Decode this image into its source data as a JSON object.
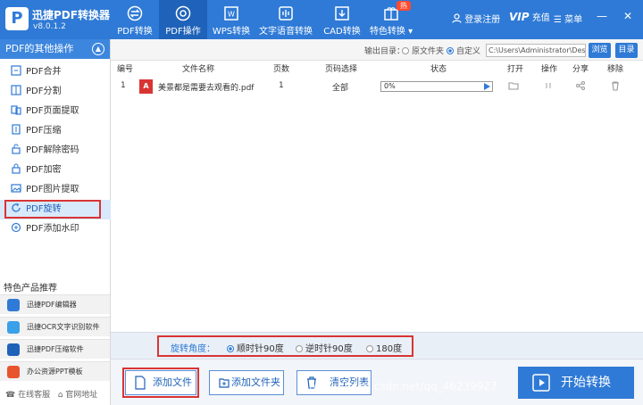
{
  "app": {
    "title": "迅捷PDF转换器",
    "version": "v8.0.1.2",
    "logo_letter": "P"
  },
  "nav": {
    "tabs": [
      {
        "label": "PDF转换",
        "icon": "convert-icon"
      },
      {
        "label": "PDF操作",
        "icon": "gear-icon",
        "active": true
      },
      {
        "label": "WPS转换",
        "icon": "wps-icon"
      },
      {
        "label": "文字语音转换",
        "icon": "audio-wave-icon"
      },
      {
        "label": "CAD转换",
        "icon": "cad-icon"
      },
      {
        "label": "特色转换",
        "icon": "gift-icon",
        "badge": "热"
      }
    ]
  },
  "topright": {
    "login": "登录注册",
    "vip": "VIP",
    "recharge": "充值",
    "menu": "菜单"
  },
  "sidebar": {
    "header": "PDF的其他操作",
    "items": [
      {
        "label": "PDF合并",
        "icon": "merge-icon"
      },
      {
        "label": "PDF分割",
        "icon": "split-icon"
      },
      {
        "label": "PDF页面提取",
        "icon": "extract-icon"
      },
      {
        "label": "PDF压缩",
        "icon": "compress-icon"
      },
      {
        "label": "PDF解除密码",
        "icon": "unlock-icon"
      },
      {
        "label": "PDF加密",
        "icon": "lock-icon"
      },
      {
        "label": "PDF图片提取",
        "icon": "image-icon"
      },
      {
        "label": "PDF旋转",
        "icon": "rotate-icon",
        "active": true
      },
      {
        "label": "PDF添加水印",
        "icon": "watermark-icon"
      }
    ],
    "promo_title": "特色产品推荐",
    "promos": [
      {
        "label": "迅捷PDF编辑器",
        "color": "#2f7ad6"
      },
      {
        "label": "迅捷OCR文字识别软件",
        "color": "#3aa0e8"
      },
      {
        "label": "迅捷PDF压缩软件",
        "color": "#1f62b9"
      },
      {
        "label": "办公资源PPT模板",
        "color": "#e8542e"
      }
    ],
    "footer": {
      "service": "在线客服",
      "website": "官网地址"
    }
  },
  "output": {
    "label": "输出目录：",
    "opt_original": "原文件夹",
    "opt_custom": "自定义",
    "path": "C:\\Users\\Administrator\\Desktop",
    "browse": "浏览",
    "dir": "目录"
  },
  "table": {
    "headers": [
      "编号",
      "文件名称",
      "页数",
      "页码选择",
      "状态",
      "打开",
      "操作",
      "分享",
      "移除"
    ],
    "rows": [
      {
        "index": "1",
        "filename": "美景都是需要去观看的.pdf",
        "pages": "1",
        "range": "全部",
        "progress": "0%",
        "progress_value": 0
      }
    ]
  },
  "rotate": {
    "label": "旋转角度：",
    "options": [
      "顺时针90度",
      "逆时针90度",
      "180度"
    ],
    "selected": 0
  },
  "buttons": {
    "add_file": "添加文件",
    "add_folder": "添加文件夹",
    "clear": "清空列表",
    "start": "开始转换"
  },
  "watermark": "https://blog.csdn.net/qq_46239927",
  "colors": {
    "primary": "#2f7ad6",
    "highlight": "#d93434"
  }
}
